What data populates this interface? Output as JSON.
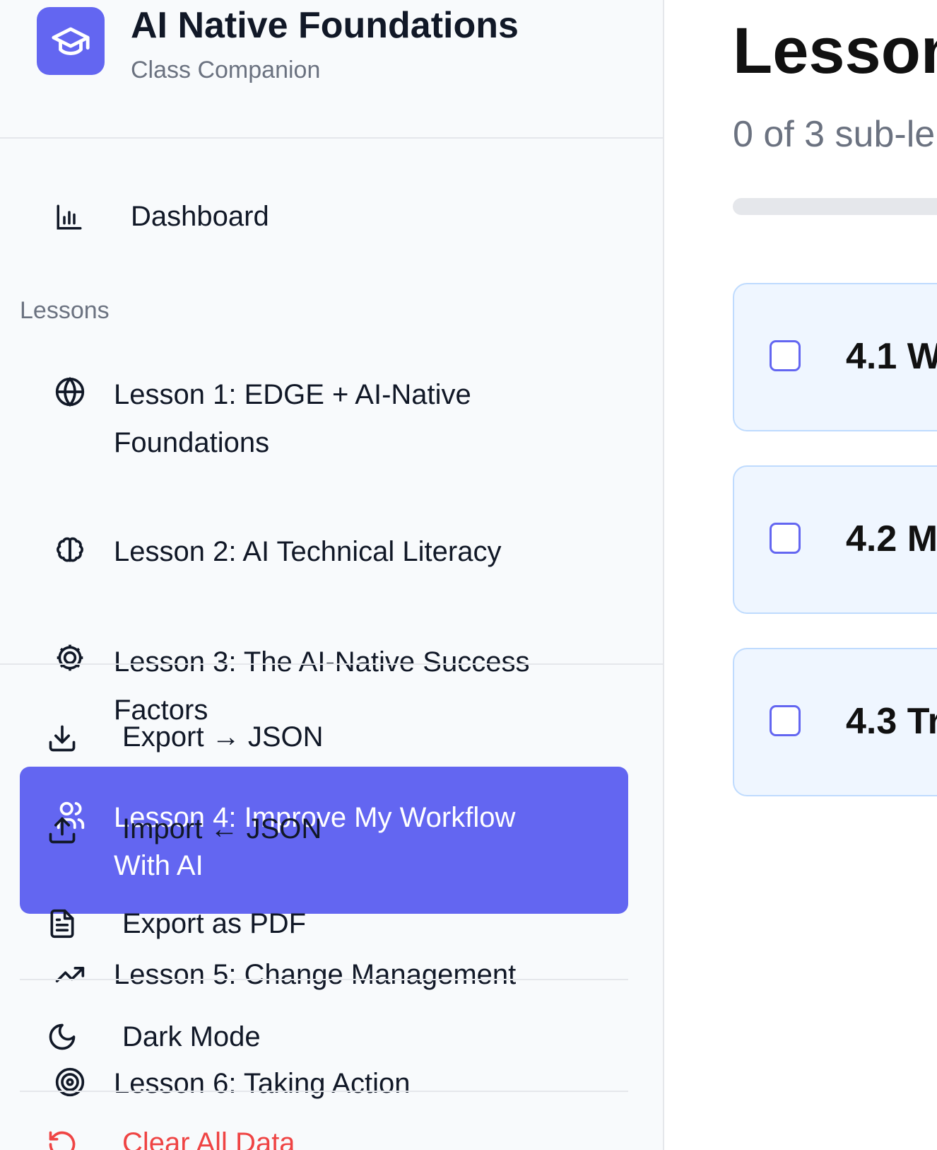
{
  "brand": {
    "title": "AI Native Foundations",
    "subtitle": "Class Companion",
    "logo_icon": "graduation-cap-icon"
  },
  "nav": {
    "dashboard": "Dashboard"
  },
  "lessons_section_label": "Lessons",
  "lessons": [
    {
      "icon": "globe-icon",
      "line1": "Lesson 1: EDGE + AI-Native",
      "line2": "Foundations"
    },
    {
      "icon": "brain-icon",
      "line1": "Lesson 2: AI Technical Literacy",
      "line2": ""
    },
    {
      "icon": "cog-icon",
      "line1": "Lesson 3: The AI-Native Success",
      "line2": "Factors"
    },
    {
      "icon": "users-icon",
      "line1": "Lesson 4: Improve My Workflow",
      "line2": "With AI",
      "active": true
    },
    {
      "icon": "trending-up-icon",
      "line1": "Lesson 5: Change Management",
      "line2": ""
    },
    {
      "icon": "target-icon",
      "line1": "Lesson 6: Taking Action",
      "line2": ""
    }
  ],
  "footer": {
    "export_json": "Export → JSON",
    "import_json": "Import ← JSON",
    "export_pdf": "Export as PDF",
    "dark_mode": "Dark Mode",
    "clear_data": "Clear All Data"
  },
  "main": {
    "title": "Lesson",
    "progress_text": "0 of 3 sub-le",
    "progress_fraction": 0,
    "cards": [
      {
        "title": "4.1 W",
        "checked": false
      },
      {
        "title": "4.2 M",
        "checked": false
      },
      {
        "title": "4.3 Tr",
        "checked": false
      }
    ]
  },
  "colors": {
    "accent": "#6366f1",
    "danger": "#ef4444",
    "sidebar_bg": "#f8fafc",
    "card_bg": "#eff6ff",
    "card_border": "#bfdbfe"
  }
}
